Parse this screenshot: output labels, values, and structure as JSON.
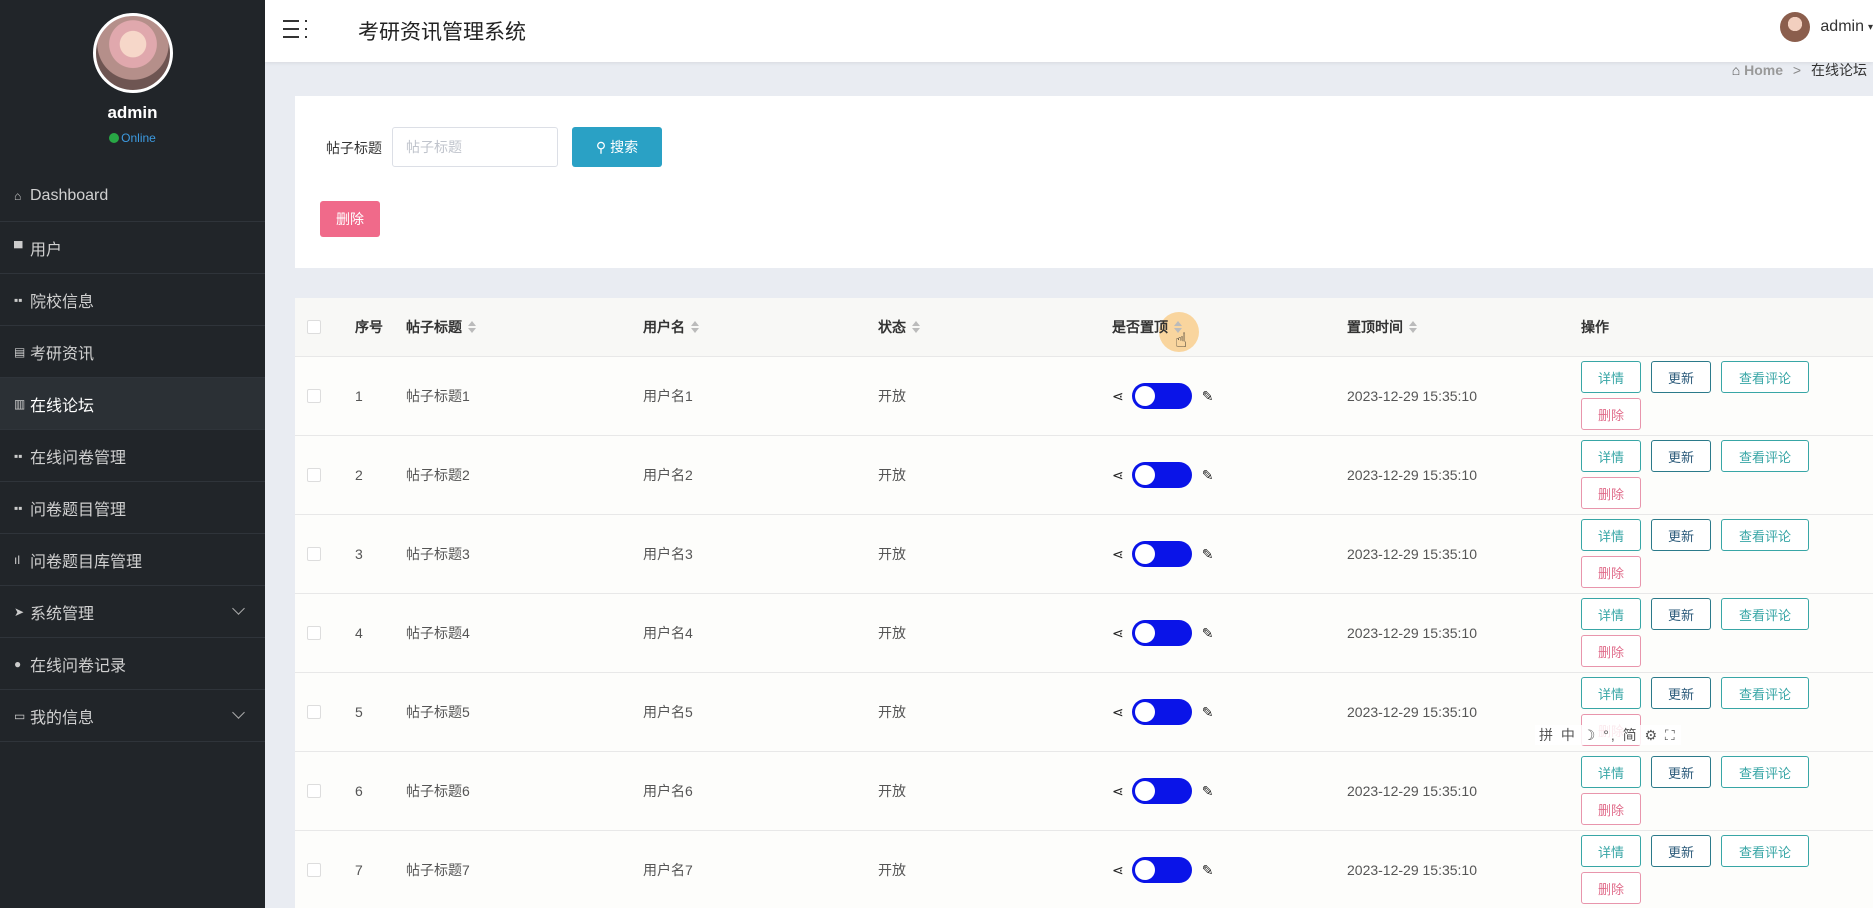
{
  "sidebar": {
    "username": "admin",
    "status": "Online",
    "items": [
      {
        "label": "Dashboard",
        "icon": "home-icon"
      },
      {
        "label": "用户",
        "icon": "user-icon"
      },
      {
        "label": "院校信息",
        "icon": "grid-icon"
      },
      {
        "label": "考研资讯",
        "icon": "doc-icon"
      },
      {
        "label": "在线论坛",
        "icon": "columns-icon"
      },
      {
        "label": "在线问卷管理",
        "icon": "grid-icon"
      },
      {
        "label": "问卷题目管理",
        "icon": "grid-icon"
      },
      {
        "label": "问卷题目库管理",
        "icon": "bar-chart-icon"
      },
      {
        "label": "系统管理",
        "icon": "send-icon"
      },
      {
        "label": "在线问卷记录",
        "icon": "pin-icon"
      },
      {
        "label": "我的信息",
        "icon": "card-icon"
      }
    ]
  },
  "header": {
    "title": "考研资讯管理系统",
    "user": "admin"
  },
  "breadcrumb": {
    "home": "Home",
    "sep": ">",
    "current": "在线论坛"
  },
  "search": {
    "label": "帖子标题",
    "placeholder": "帖子标题",
    "value": "",
    "button": "搜索",
    "delete_button": "删除"
  },
  "table": {
    "columns": [
      "序号",
      "帖子标题",
      "用户名",
      "状态",
      "是否置顶",
      "置顶时间",
      "操作"
    ],
    "actions": {
      "detail": "详情",
      "update": "更新",
      "comments": "查看评论",
      "delete": "删除"
    },
    "rows": [
      {
        "index": "1",
        "title": "帖子标题1",
        "user": "用户名1",
        "status": "开放",
        "pinned": true,
        "pin_time": "2023-12-29 15:35:10"
      },
      {
        "index": "2",
        "title": "帖子标题2",
        "user": "用户名2",
        "status": "开放",
        "pinned": true,
        "pin_time": "2023-12-29 15:35:10"
      },
      {
        "index": "3",
        "title": "帖子标题3",
        "user": "用户名3",
        "status": "开放",
        "pinned": true,
        "pin_time": "2023-12-29 15:35:10"
      },
      {
        "index": "4",
        "title": "帖子标题4",
        "user": "用户名4",
        "status": "开放",
        "pinned": true,
        "pin_time": "2023-12-29 15:35:10"
      },
      {
        "index": "5",
        "title": "帖子标题5",
        "user": "用户名5",
        "status": "开放",
        "pinned": true,
        "pin_time": "2023-12-29 15:35:10"
      },
      {
        "index": "6",
        "title": "帖子标题6",
        "user": "用户名6",
        "status": "开放",
        "pinned": true,
        "pin_time": "2023-12-29 15:35:10"
      },
      {
        "index": "7",
        "title": "帖子标题7",
        "user": "用户名7",
        "status": "开放",
        "pinned": true,
        "pin_time": "2023-12-29 15:35:10"
      }
    ]
  },
  "ime_toolbar": "拼 中 ☽ °, 简 ⚙ ⛶"
}
